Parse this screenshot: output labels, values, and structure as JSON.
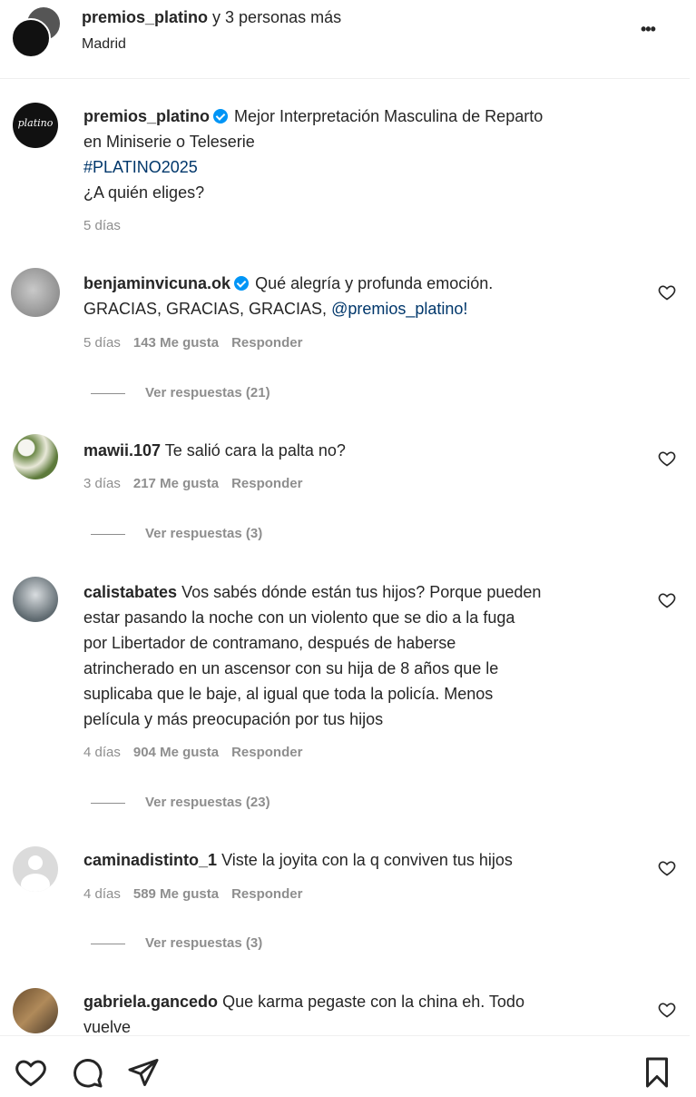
{
  "header": {
    "title_user": "premios_platino",
    "title_rest": " y 3 personas más",
    "location": "Madrid",
    "more": "•••"
  },
  "caption": {
    "username": "premios_platino",
    "text_line1": "Mejor Interpretación Masculina de Reparto",
    "text_line2": "en Miniserie o Teleserie",
    "hashtag": "#PLATINO2025",
    "question": "¿A quién eliges?",
    "time": "5 días",
    "avatar_text": "platino"
  },
  "comments": [
    {
      "username": "benjaminvicuna.ok",
      "text_line1": "Qué alegría y profunda emoción.",
      "text_line2": "GRACIAS, GRACIAS, GRACIAS,",
      "mention": "@premios_platino!",
      "time": "5 días",
      "likes": "143 Me gusta",
      "reply": "Responder",
      "view_replies": "Ver respuestas (21)"
    },
    {
      "username": "mawii.107",
      "text": "Te salió cara la palta no?",
      "time": "3 días",
      "likes": "217 Me gusta",
      "reply": "Responder",
      "view_replies": "Ver respuestas (3)"
    },
    {
      "username": "calistabates",
      "lines": [
        "Vos sabés dónde están tus hijos? Porque pueden",
        "estar pasando la noche con un violento que se dio a la fuga",
        "por Libertador de contramano, después de haberse",
        "atrincherado en un ascensor con su hija de 8 años que le",
        "suplicaba que le baje, al igual que toda la policía. Menos",
        "película y más preocupación por tus hijos"
      ],
      "time": "4 días",
      "likes": "904 Me gusta",
      "reply": "Responder",
      "view_replies": "Ver respuestas (23)"
    },
    {
      "username": "caminadistinto_1",
      "text": "Viste la joyita con la q conviven tus hijos",
      "time": "4 días",
      "likes": "589 Me gusta",
      "reply": "Responder",
      "view_replies": "Ver respuestas (3)"
    },
    {
      "username": "gabriela.gancedo",
      "text_line1": "Que karma pegaste con la china eh. Todo",
      "text_line2": "vuelve"
    }
  ],
  "actions": {
    "like_icon": "heart-icon",
    "comment_icon": "comment-icon",
    "share_icon": "send-icon",
    "save_icon": "bookmark-icon"
  }
}
